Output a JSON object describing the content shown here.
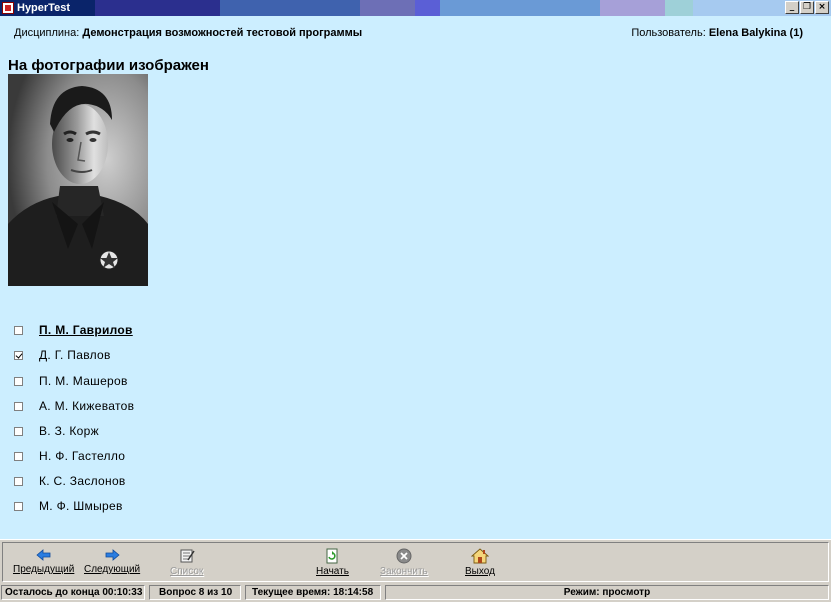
{
  "window": {
    "title": "HyperTest",
    "minimize_glyph": "_",
    "restore_glyph": "❐",
    "close_glyph": "×"
  },
  "header": {
    "discipline_label": "Дисциплина:",
    "discipline_value": "Демонстрация возможностей тестовой программы",
    "user_label": "Пользователь:",
    "user_value": "Elena Balykina (1)"
  },
  "question": {
    "text": "На фотографии изображен"
  },
  "answers": [
    {
      "label": "П. М.  Гаврилов",
      "checked": false,
      "highlighted": true
    },
    {
      "label": "Д. Г.  Павлов",
      "checked": true,
      "highlighted": false
    },
    {
      "label": "П. М. Машеров",
      "checked": false,
      "highlighted": false
    },
    {
      "label": "А. М. Кижеватов",
      "checked": false,
      "highlighted": false
    },
    {
      "label": "В. З.  Корж",
      "checked": false,
      "highlighted": false
    },
    {
      "label": "Н. Ф.  Гастелло",
      "checked": false,
      "highlighted": false
    },
    {
      "label": "К. С.  Заслонов",
      "checked": false,
      "highlighted": false
    },
    {
      "label": "М. Ф.  Шмырев",
      "checked": false,
      "highlighted": false
    }
  ],
  "toolbar": {
    "prev_label": "Предыдущий",
    "next_label": "Следующий",
    "list_label": "Список",
    "start_label": "Начать",
    "finish_label": "Закончить",
    "exit_label": "Выход"
  },
  "status": {
    "time_left": "Осталось до конца 00:10:33",
    "question_counter": "Вопрос 8 из 10",
    "current_time": "Текущее время: 18:14:58",
    "mode": "Режим: просмотр"
  },
  "colors": {
    "background": "#cceeff",
    "title_gradient": [
      "#0a246a",
      "#2b3f96",
      "#3f62ae",
      "#6d6fb6",
      "#5e8ed0",
      "#8fb3e6",
      "#a6a0d8",
      "#9ed0d8",
      "#a6caf0"
    ],
    "accent_arrow": "#2a7de1"
  }
}
